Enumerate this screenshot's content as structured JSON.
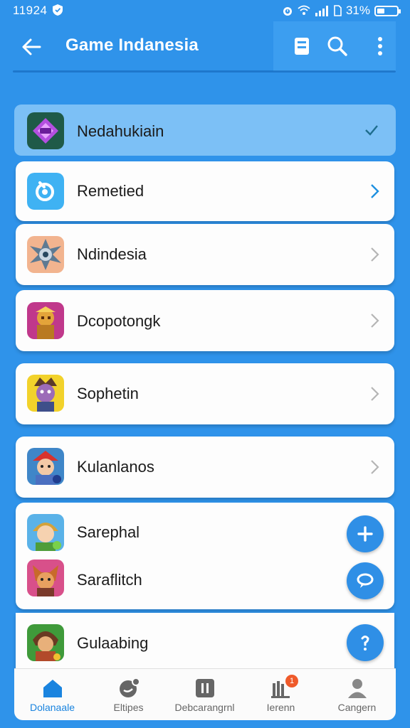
{
  "status_bar": {
    "time": "11924",
    "battery": "31%",
    "icons": [
      "shield-icon",
      "alarm-icon",
      "wifi-icon",
      "signal-icon",
      "battery-icon"
    ]
  },
  "app_bar": {
    "title": "Game Indanesia",
    "icons": [
      "back-arrow-icon",
      "bookmark-icon",
      "search-icon",
      "more-vert-icon"
    ]
  },
  "list": {
    "items": [
      {
        "label": "Nedahukiain",
        "icon": "diamond-game-icon",
        "selected": true
      },
      {
        "label": "Remetied",
        "icon": "ring-app-icon"
      },
      {
        "label": "Ndindesia",
        "icon": "spiky-robot-game-icon"
      },
      {
        "label": "Dcopotongk",
        "icon": "golden-warrior-game-icon"
      },
      {
        "label": "Sophetin",
        "icon": "purple-character-game-icon"
      },
      {
        "label": "Kulanlanos",
        "icon": "red-hat-character-game-icon"
      },
      {
        "label": "Sarephal",
        "icon": "blonde-character-game-icon"
      },
      {
        "label": "Saraflitch",
        "icon": "fox-character-game-icon"
      },
      {
        "label": "Gulaabing",
        "icon": "hooded-character-game-icon"
      }
    ]
  },
  "fabs": [
    "plus-icon",
    "chat-bubble-icon",
    "question-icon"
  ],
  "bottom_nav": {
    "items": [
      {
        "label": "Dolanaale",
        "icon": "home-icon",
        "active": true
      },
      {
        "label": "Eltipes",
        "icon": "chat-bubble-icon"
      },
      {
        "label": "Debcarangrnl",
        "icon": "pause-square-icon"
      },
      {
        "label": "Ierenn",
        "icon": "library-icon",
        "badge": "1"
      },
      {
        "label": "Cangern",
        "icon": "person-icon"
      }
    ]
  },
  "colors": {
    "background": "#2f93ea",
    "selected_row": "#7cc0f6",
    "accent": "#1a84df",
    "badge": "#ef5a2a"
  }
}
